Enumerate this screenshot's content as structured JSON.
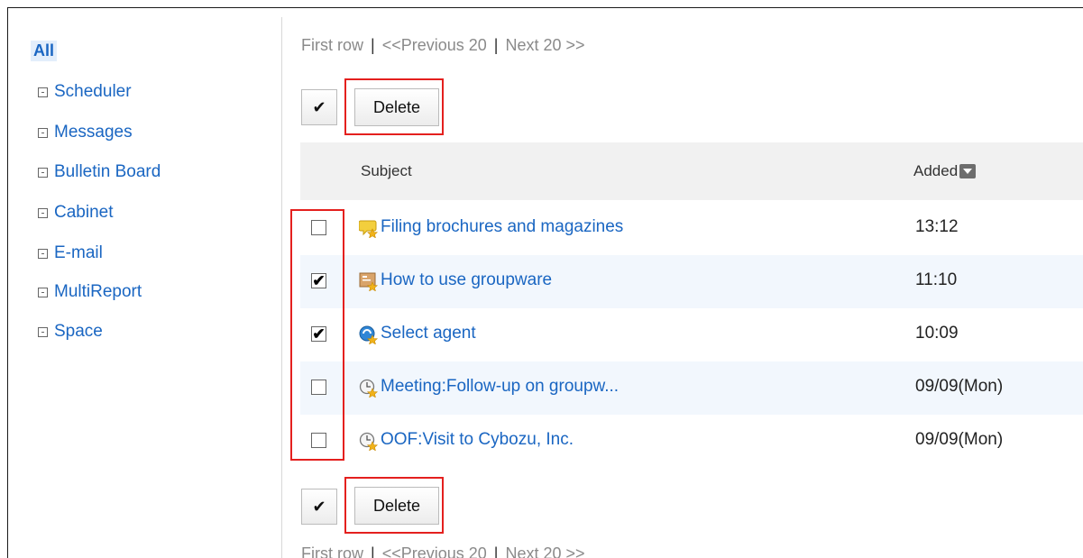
{
  "sidebar": {
    "all_label": "All",
    "items": [
      {
        "label": "Scheduler"
      },
      {
        "label": "Messages"
      },
      {
        "label": "Bulletin Board"
      },
      {
        "label": "Cabinet"
      },
      {
        "label": "E-mail"
      },
      {
        "label": "MultiReport"
      },
      {
        "label": "Space"
      }
    ]
  },
  "pager": {
    "first_row": "First row",
    "separator": "|",
    "previous": "<<Previous 20",
    "next": "Next 20 >>"
  },
  "toolbar": {
    "check_all_glyph": "✔",
    "delete_label": "Delete"
  },
  "table": {
    "columns": {
      "subject": "Subject",
      "added": "Added"
    },
    "rows": [
      {
        "subject": "Filing brochures and magazines",
        "added": "13:12",
        "checked": false,
        "icon": "message-icon"
      },
      {
        "subject": "How to use groupware",
        "added": "11:10",
        "checked": true,
        "icon": "bulletin-board-icon"
      },
      {
        "subject": "Select agent",
        "added": "10:09",
        "checked": true,
        "icon": "workflow-icon"
      },
      {
        "subject": "Meeting:Follow-up on groupw...",
        "added": "09/09(Mon)",
        "checked": false,
        "icon": "scheduler-icon"
      },
      {
        "subject": "OOF:Visit to Cybozu, Inc.",
        "added": "09/09(Mon)",
        "checked": false,
        "icon": "scheduler-icon"
      }
    ]
  },
  "colors": {
    "link": "#1a66c2",
    "highlight_box": "#e4201e",
    "alt_row": "#f2f7fd",
    "header_bg": "#f1f1f1"
  }
}
